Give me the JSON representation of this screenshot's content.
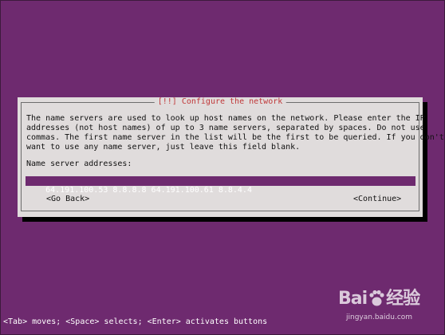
{
  "dialog": {
    "title": "[!!] Configure the network",
    "body_lines": [
      "The name servers are used to look up host names on the network. Please enter the IP",
      "addresses (not host names) of up to 3 name servers, separated by spaces. Do not use",
      "commas. The first name server in the list will be the first to be queried. If you don't",
      "want to use any name server, just leave this field blank."
    ],
    "field_label": "Name server addresses:",
    "field_value": "64.191.100.53 8.8.8.8 64.191.100.61 8.8.4.4",
    "back_button": "<Go Back>",
    "continue_button": "<Continue>"
  },
  "status_bar": "<Tab> moves; <Space> selects; <Enter> activates buttons",
  "watermark": {
    "logo_left": "Bai",
    "logo_right": "经验",
    "url": "jingyan.baidu.com"
  },
  "colors": {
    "background": "#6e2a6f",
    "dialog": "#e0dcdc",
    "title": "#c0393a",
    "input": "#6e2a6f"
  }
}
